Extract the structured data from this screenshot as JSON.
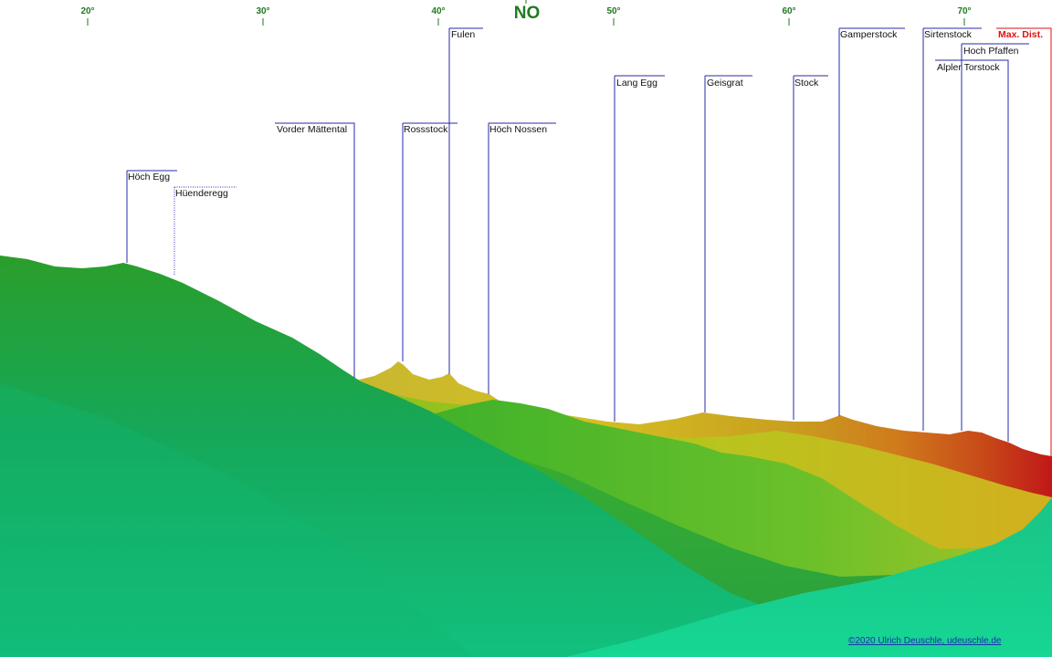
{
  "compass": {
    "ticks": [
      {
        "label": "20°"
      },
      {
        "label": "30°"
      },
      {
        "label": "40°"
      },
      {
        "label": "50°"
      },
      {
        "label": "60°"
      },
      {
        "label": "70°"
      }
    ],
    "direction": "NO"
  },
  "peaks": [
    {
      "name": "Höch Egg"
    },
    {
      "name": "Hüenderegg"
    },
    {
      "name": "Vorder Mättental"
    },
    {
      "name": "Rossstock"
    },
    {
      "name": "Fulen"
    },
    {
      "name": "Höch Nossen"
    },
    {
      "name": "Lang Egg"
    },
    {
      "name": "Geisgrat"
    },
    {
      "name": "Stock"
    },
    {
      "name": "Gamperstock"
    },
    {
      "name": "Sirtenstock"
    },
    {
      "name": "Hoch Pfaffen"
    },
    {
      "name": "Alpler Torstock"
    }
  ],
  "max_distance_label": "Max. Dist.",
  "credit": "©2020 Ulrich Deuschle, udeuschle.de",
  "colors": {
    "near_terrain": "#16d089",
    "mid_terrain": "#2aa82a",
    "ridge_yellow": "#d8c21e",
    "far_orange": "#d0701a",
    "far_red": "#c01818",
    "leader": "#2a2aa8",
    "tick": "#1f7a1f",
    "max_dist": "#e01010"
  }
}
